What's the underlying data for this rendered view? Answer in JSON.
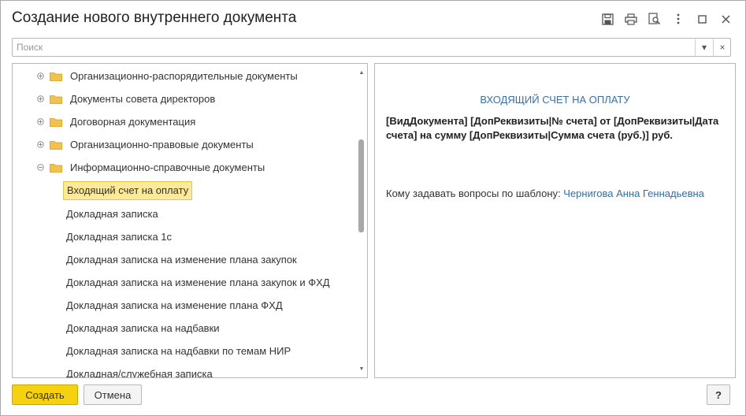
{
  "window": {
    "title": "Создание нового внутреннего документа"
  },
  "titlebar_icons": [
    "save-icon",
    "print-icon",
    "print-preview-icon",
    "more-icon",
    "maximize-icon",
    "close-icon"
  ],
  "search": {
    "placeholder": "Поиск",
    "value": "",
    "dropdown_icon": "▾",
    "clear_icon": "×"
  },
  "tree": {
    "groups": [
      {
        "label": "Организационно-распорядительные документы",
        "expanded": false
      },
      {
        "label": "Документы совета директоров",
        "expanded": false
      },
      {
        "label": "Договорная документация",
        "expanded": false
      },
      {
        "label": "Организационно-правовые документы",
        "expanded": false
      },
      {
        "label": "Информационно-справочные документы",
        "expanded": true
      }
    ],
    "items": [
      {
        "label": "Входящий счет на оплату",
        "selected": true
      },
      {
        "label": "Докладная записка",
        "selected": false
      },
      {
        "label": "Докладная записка 1с",
        "selected": false
      },
      {
        "label": "Докладная записка на изменение плана закупок",
        "selected": false
      },
      {
        "label": "Докладная записка на изменение плана закупок и ФХД",
        "selected": false
      },
      {
        "label": "Докладная записка на изменение плана ФХД",
        "selected": false
      },
      {
        "label": "Докладная записка на надбавки",
        "selected": false
      },
      {
        "label": "Докладная записка на надбавки по темам НИР",
        "selected": false
      },
      {
        "label": "Докладная/служебная записка",
        "selected": false
      }
    ]
  },
  "preview": {
    "heading": "ВХОДЯЩИЙ СЧЕТ НА ОПЛАТУ",
    "body": "[ВидДокумента] [ДопРеквизиты|№ счета] от [ДопРеквизиты|Дата счета] на сумму [ДопРеквизиты|Сумма счета (руб.)] руб.",
    "questions_label": "Кому задавать вопросы по шаблону:",
    "questions_contact": "Чернигова Анна Геннадьевна"
  },
  "buttons": {
    "create": "Создать",
    "cancel": "Отмена",
    "help": "?"
  },
  "colors": {
    "accent_button": "#f5d10f",
    "selection": "#fde99a",
    "link": "#2f6fa8",
    "folder": "#f2c14e"
  }
}
